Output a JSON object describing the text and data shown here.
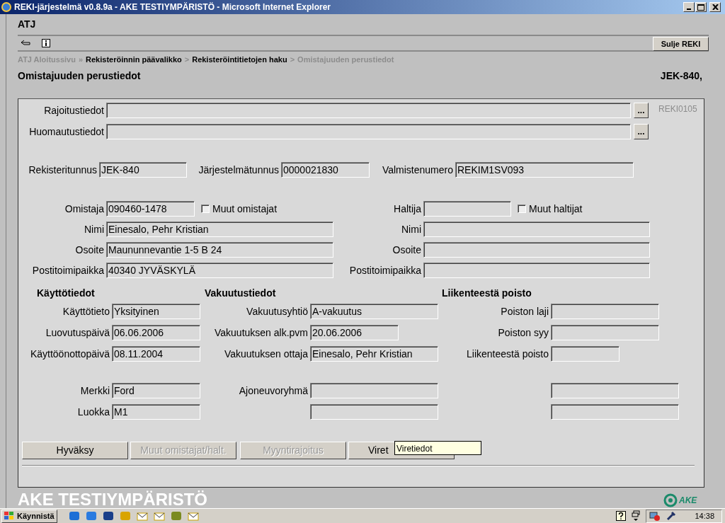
{
  "window": {
    "title": "REKI-järjestelmä v0.8.9a - AKE TESTIYMPÄRISTÖ - Microsoft Internet Explorer"
  },
  "app_title": "ATJ",
  "close_button": "Sulje REKI",
  "breadcrumb": [
    {
      "kind": "muted",
      "label": "ATJ Aloitussivu"
    },
    {
      "kind": "muted",
      "label": "»"
    },
    {
      "kind": "link",
      "label": "Rekisteröinnin päävalikko"
    },
    {
      "kind": "muted",
      "label": ">"
    },
    {
      "kind": "link",
      "label": "Rekisteröintitietojen haku"
    },
    {
      "kind": "muted",
      "label": ">"
    },
    {
      "kind": "muted",
      "label": "Omistajuuden perustiedot"
    }
  ],
  "page_title": "Omistajuuden perustiedot",
  "vehicle_id": "JEK-840,",
  "screen_code": "REKI0105",
  "note_fields": [
    {
      "label": "Rajoitustiedot",
      "button": "..."
    },
    {
      "label": "Huomautustiedot",
      "button": "..."
    }
  ],
  "identifiers": [
    {
      "label": "Rekisteritunnus",
      "value": "JEK-840"
    },
    {
      "label": "Järjestelmätunnus",
      "value": "0000021830"
    },
    {
      "label": "Valmistenumero",
      "value": "REKIM1SV093"
    }
  ],
  "owner": {
    "label": "Omistaja",
    "value": "090460-1478",
    "checkbox": {
      "label": "Muut omistajat",
      "checked": false
    },
    "fields": [
      {
        "label": "Nimi",
        "value": "Einesalo, Pehr Kristian"
      },
      {
        "label": "Osoite",
        "value": "Maununnevantie 1-5 B 24"
      },
      {
        "label": "Postitoimipaikka",
        "value": "40340 JYVÄSKYLÄ"
      }
    ]
  },
  "holder": {
    "label": "Haltija",
    "checkbox": {
      "label": "Muut haltijat",
      "checked": false
    },
    "fields": [
      {
        "label": "Nimi"
      },
      {
        "label": "Osoite"
      },
      {
        "label": "Postitoimipaikka"
      }
    ]
  },
  "sections": [
    {
      "title": "Käyttötiedot",
      "fields": [
        {
          "label": "Käyttötieto",
          "value": "Yksityinen"
        },
        {
          "label": "Luovutuspäivä",
          "value": "06.06.2006"
        },
        {
          "label": "Käyttöönottopäivä",
          "value": "08.11.2004"
        }
      ]
    },
    {
      "title": "Vakuutustiedot",
      "fields": [
        {
          "label": "Vakuutusyhtiö",
          "value": "A-vakuutus"
        },
        {
          "label": "Vakuutuksen alk.pvm",
          "value": "20.06.2006"
        },
        {
          "label": "Vakuutuksen ottaja",
          "value": "Einesalo, Pehr Kristian"
        }
      ]
    },
    {
      "title": "Liikenteestä poisto",
      "fields": [
        {
          "label": "Poiston laji"
        },
        {
          "label": "Poiston syy"
        },
        {
          "label": "Liikenteestä poisto"
        }
      ]
    }
  ],
  "vehicle_fields": [
    [
      {
        "label": "Merkki",
        "value": "Ford"
      },
      {
        "label": "Ajoneuvoryhmä"
      }
    ],
    [
      {
        "label": "Luokka",
        "value": "M1"
      }
    ]
  ],
  "buttons": [
    {
      "label": "Hyväksy",
      "disabled": false
    },
    {
      "label": "Muut omistajat/halt.",
      "disabled": true
    },
    {
      "label": "Myyntirajoitus",
      "disabled": true
    },
    {
      "label": "Viret",
      "disabled": false
    }
  ],
  "tooltip": "Viretiedot",
  "environment_banner": "AKE TESTIYMPÄRISTÖ",
  "logo_text": "AKE",
  "taskbar": {
    "start": "Käynnistä",
    "clock": "14:38"
  }
}
